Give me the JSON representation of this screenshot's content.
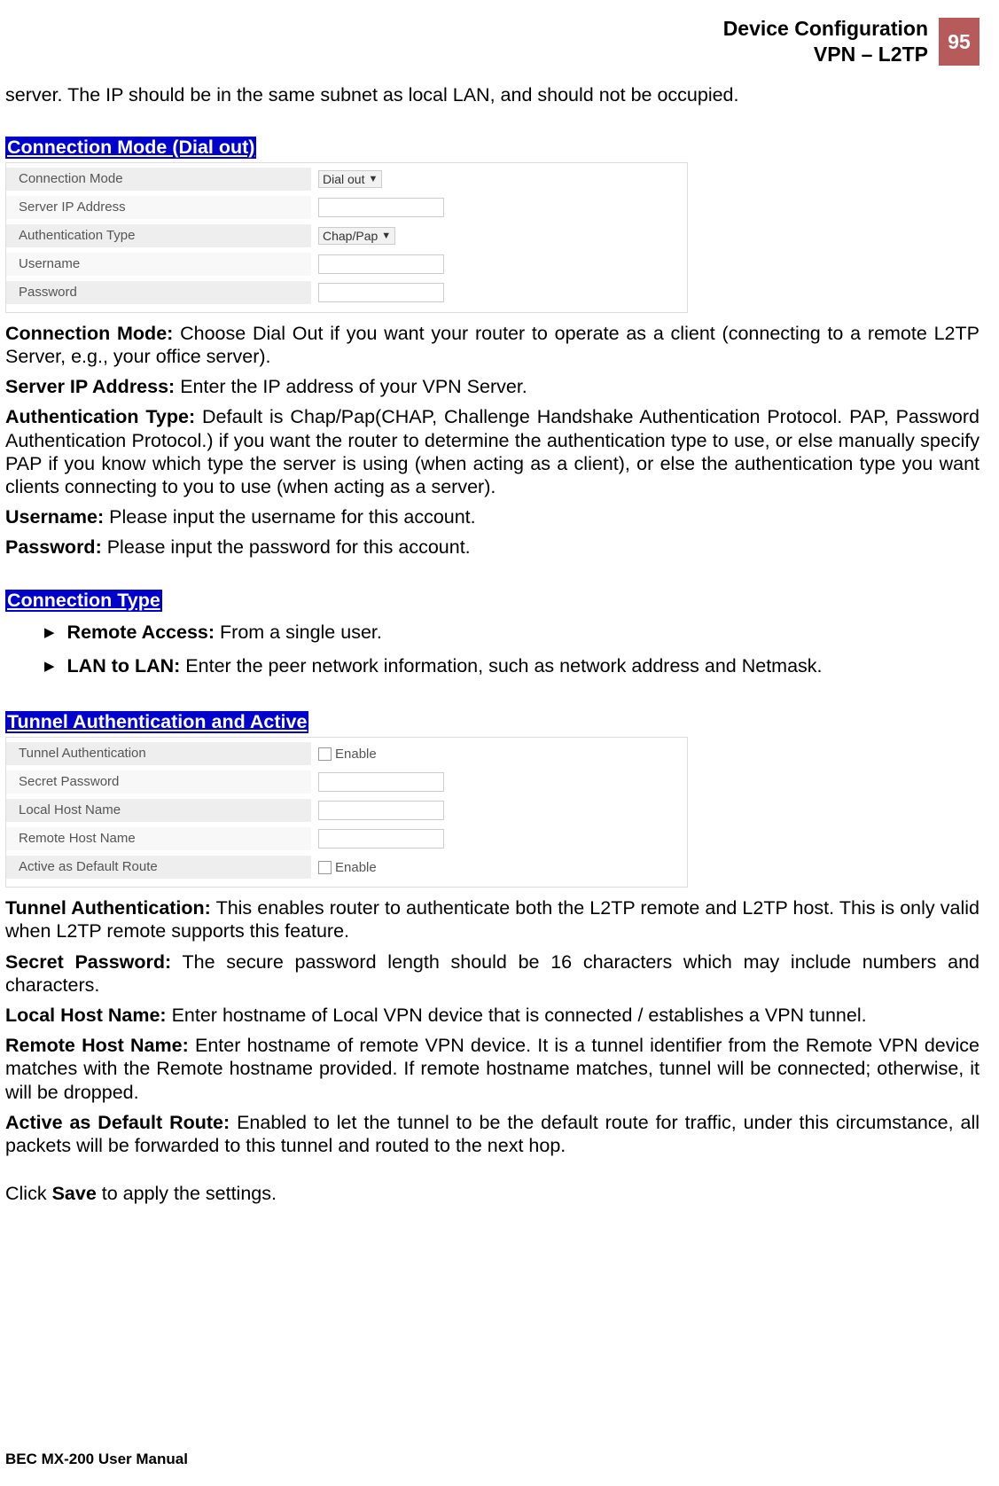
{
  "header": {
    "line1": "Device Configuration",
    "line2": "VPN – L2TP",
    "page_num": "95"
  },
  "intro_continuation": "server. The IP should be in the same subnet as local LAN, and should not be occupied.",
  "section1": {
    "title": "Connection Mode (Dial out)",
    "rows": {
      "r1_label": "Connection Mode",
      "r1_value": "Dial out",
      "r2_label": "Server IP Address",
      "r3_label": "Authentication Type",
      "r3_value": "Chap/Pap",
      "r4_label": "Username",
      "r5_label": "Password"
    },
    "p_conn_mode_label": "Connection Mode:",
    "p_conn_mode_text": " Choose Dial Out if you want your router to operate as a client (connecting to a remote L2TP Server, e.g., your office server).",
    "p_server_ip_label": "Server IP Address:",
    "p_server_ip_text": " Enter the IP address of your VPN Server.",
    "p_auth_label": "Authentication Type:",
    "p_auth_text": " Default is Chap/Pap(CHAP, Challenge Handshake Authentication Protocol. PAP, Password Authentication Protocol.) if you want the router to determine the authentication type to use, or else manually specify PAP if you know which type the server is using (when acting as a client), or else the authentication type you want clients connecting to you to use (when acting as a server).",
    "p_user_label": "Username:",
    "p_user_text": " Please input the username for this account.",
    "p_pass_label": "Password:",
    "p_pass_text": " Please input the password for this account."
  },
  "section2": {
    "title": "Connection Type",
    "b1_label": "Remote Access:",
    "b1_text": " From a single user.",
    "b2_label": "LAN to LAN:",
    "b2_text": " Enter the peer network information, such as network address and Netmask."
  },
  "section3": {
    "title": "Tunnel Authentication and Active",
    "rows": {
      "r1_label": "Tunnel Authentication",
      "enable": "Enable",
      "r2_label": "Secret Password",
      "r3_label": "Local Host Name",
      "r4_label": "Remote Host Name",
      "r5_label": "Active as Default Route"
    },
    "p_ta_label": "Tunnel Authentication:",
    "p_ta_text": " This enables router to authenticate both the L2TP remote and L2TP host. This is only valid when L2TP remote supports this feature.",
    "p_sp_label": "Secret Password:",
    "p_sp_text": " The secure password length should be 16 characters which may include numbers and characters.",
    "p_lh_label": "Local Host Name:",
    "p_lh_text": " Enter hostname of Local VPN device that is connected / establishes a VPN tunnel.",
    "p_rh_label": "Remote Host Name:",
    "p_rh_text": " Enter hostname of remote VPN device. It is a tunnel identifier from the Remote VPN device matches with the Remote hostname provided. If remote hostname matches, tunnel will be connected; otherwise, it will be dropped.",
    "p_adr_label": "Active as Default Route:",
    "p_adr_text": " Enabled to let the tunnel to be the default route for traffic, under this circumstance, all packets will be forwarded to this tunnel and routed to the next hop."
  },
  "save_prefix": "Click ",
  "save_bold": "Save",
  "save_suffix": " to apply the settings.",
  "footer": "BEC MX-200 User Manual"
}
